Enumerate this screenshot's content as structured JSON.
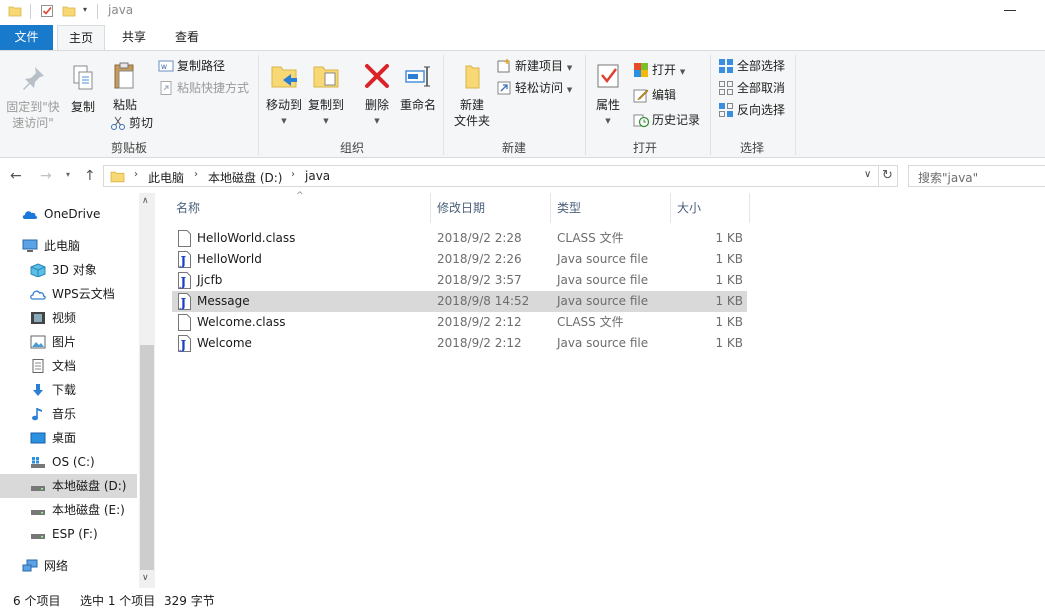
{
  "window": {
    "title": "java"
  },
  "tabs": [
    {
      "label": "文件"
    },
    {
      "label": "主页"
    },
    {
      "label": "共享"
    },
    {
      "label": "查看"
    }
  ],
  "ribbon": {
    "clipboard": {
      "group_label": "剪贴板",
      "pin_quick_access_line1": "固定到\"快",
      "pin_quick_access_line2": "速访问\"",
      "copy": "复制",
      "paste": "粘贴",
      "copy_path": "复制路径",
      "paste_shortcut": "粘贴快捷方式",
      "cut": "剪切"
    },
    "organize": {
      "group_label": "组织",
      "move_to": "移动到",
      "copy_to": "复制到",
      "delete": "删除",
      "rename": "重命名"
    },
    "new": {
      "group_label": "新建",
      "new_folder_line1": "新建",
      "new_folder_line2": "文件夹",
      "new_item": "新建项目",
      "easy_access": "轻松访问"
    },
    "open": {
      "group_label": "打开",
      "properties": "属性",
      "open": "打开",
      "edit": "编辑",
      "history": "历史记录"
    },
    "select": {
      "group_label": "选择",
      "select_all": "全部选择",
      "select_none": "全部取消",
      "invert_selection": "反向选择"
    }
  },
  "address": {
    "crumbs": [
      "此电脑",
      "本地磁盘 (D:)",
      "java"
    ],
    "search_placeholder": "搜索\"java\""
  },
  "nav": {
    "items": [
      {
        "label": "OneDrive"
      },
      {
        "label": "此电脑"
      },
      {
        "label": "3D 对象"
      },
      {
        "label": "WPS云文档"
      },
      {
        "label": "视频"
      },
      {
        "label": "图片"
      },
      {
        "label": "文档"
      },
      {
        "label": "下载"
      },
      {
        "label": "音乐"
      },
      {
        "label": "桌面"
      },
      {
        "label": "OS (C:)"
      },
      {
        "label": "本地磁盘 (D:)"
      },
      {
        "label": "本地磁盘 (E:)"
      },
      {
        "label": "ESP (F:)"
      },
      {
        "label": "网络"
      }
    ]
  },
  "list": {
    "headers": {
      "name": "名称",
      "date": "修改日期",
      "type": "类型",
      "size": "大小"
    },
    "rows": [
      {
        "name": "HelloWorld.class",
        "date": "2018/9/2 2:28",
        "type": "CLASS 文件",
        "size": "1 KB"
      },
      {
        "name": "HelloWorld",
        "date": "2018/9/2 2:26",
        "type": "Java source file",
        "size": "1 KB"
      },
      {
        "name": "Jjcfb",
        "date": "2018/9/2 3:57",
        "type": "Java source file",
        "size": "1 KB"
      },
      {
        "name": "Message",
        "date": "2018/9/8 14:52",
        "type": "Java source file",
        "size": "1 KB"
      },
      {
        "name": "Welcome.class",
        "date": "2018/9/2 2:12",
        "type": "CLASS 文件",
        "size": "1 KB"
      },
      {
        "name": "Welcome",
        "date": "2018/9/2 2:12",
        "type": "Java source file",
        "size": "1 KB"
      }
    ]
  },
  "status": {
    "count": "6 个项目",
    "selected": "选中 1 个项目",
    "bytes": "329 字节"
  }
}
